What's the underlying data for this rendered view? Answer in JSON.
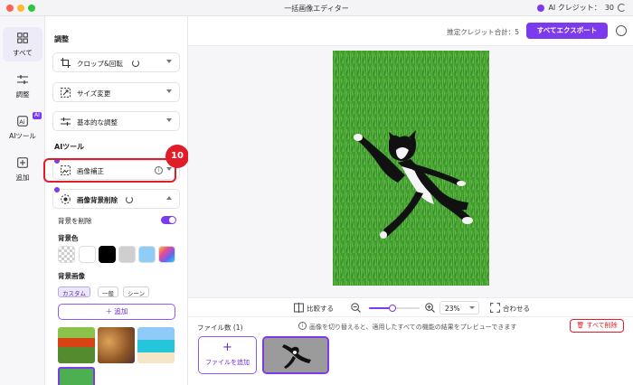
{
  "window": {
    "title": "一括画像エディター"
  },
  "credits": {
    "label": "AI クレジット：",
    "value": "30"
  },
  "nav": {
    "items": [
      {
        "label": "すべて",
        "icon": "grid-icon"
      },
      {
        "label": "調整",
        "icon": "sliders-icon"
      },
      {
        "label": "AIツール",
        "icon": "ai-tools-icon",
        "badge": "AI"
      },
      {
        "label": "追加",
        "icon": "add-square-icon"
      }
    ]
  },
  "panel": {
    "adjust_title": "調整",
    "adjust_tools": [
      {
        "label": "クロップ&回転",
        "icon": "crop-icon"
      },
      {
        "label": "サイズ変更",
        "icon": "resize-icon"
      },
      {
        "label": "基本的な調整",
        "icon": "sliders-icon"
      }
    ],
    "ai_title": "AIツール",
    "ai_tools": [
      {
        "label": "画像補正",
        "icon": "enhance-icon"
      },
      {
        "label": "画像背景削除",
        "icon": "bg-remove-icon"
      }
    ],
    "step_badge": "10",
    "remove_bg_label": "背景を削除",
    "remove_bg_on": true,
    "bg_color_label": "背景色",
    "bg_colors": [
      "transparent",
      "#ffffff",
      "#000000",
      "#cfcfcf",
      "#8ecdf7",
      "gradient"
    ],
    "bg_image_label": "背景画像",
    "bg_image_tabs": [
      "カスタム",
      "一般",
      "シーン"
    ],
    "add_label": "＋ 追加",
    "bg_thumbs": [
      "poppy-field",
      "autumn-leaves",
      "tropical-sea",
      "green-grass"
    ]
  },
  "topbar": {
    "estimate_label": "推定クレジット合計：",
    "estimate_value": "5",
    "export_label": "すべてエクスポート"
  },
  "zoombar": {
    "compare_label": "比較する",
    "zoom_level": 0.23,
    "zoom_value": "23%",
    "fit_label": "合わせる"
  },
  "filebar": {
    "file_count": "ファイル数 (1)",
    "hint": "画像を切り替えると、適用したすべての機能の結果をプレビューできます",
    "delete_all": "すべて削除",
    "add_file_label": "ファイルを追加"
  },
  "colors": {
    "accent": "#7c3aed",
    "danger": "#e11d2a"
  }
}
